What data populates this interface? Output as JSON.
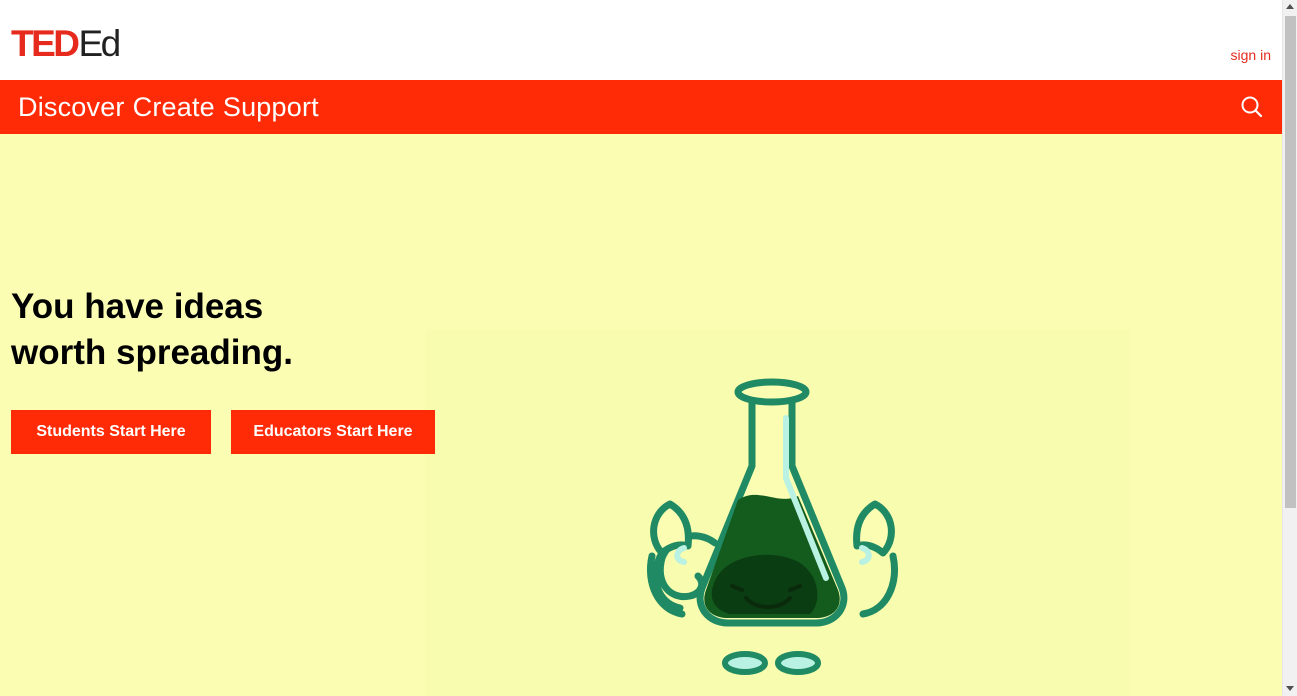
{
  "header": {
    "logo": {
      "part1": "TED",
      "part2": "Ed"
    },
    "sign_in_label": "sign in"
  },
  "nav": {
    "items": [
      {
        "label": "Discover"
      },
      {
        "label": "Create"
      },
      {
        "label": "Support"
      }
    ],
    "search_icon": "search-icon"
  },
  "hero": {
    "headline_line1": "You have ideas",
    "headline_line2": "worth spreading.",
    "students_button": "Students Start Here",
    "educators_button": "Educators Start Here",
    "illustration": "flexing-flask-illustration"
  },
  "colors": {
    "brand_red": "#ff2b06",
    "logo_red": "#e62b1e",
    "hero_background": "#fafdb2",
    "flask_green": "#1f8a63"
  }
}
